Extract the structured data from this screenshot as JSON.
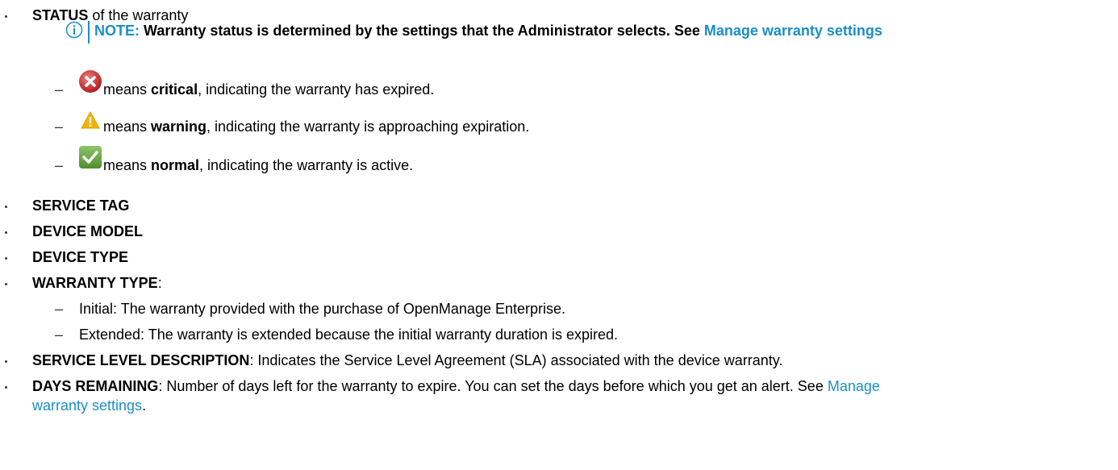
{
  "status_item": {
    "label": "STATUS",
    "rest": " of the warranty"
  },
  "note": {
    "label": "NOTE:",
    "text": " Warranty status is determined by the settings that the Administrator selects. See ",
    "link": "Manage warranty settings"
  },
  "status_critical": {
    "pre": " means ",
    "bold": "critical",
    "post": ", indicating the warranty has expired.",
    "icon": "critical-icon"
  },
  "status_warning": {
    "pre": " means ",
    "bold": "warning",
    "post": ", indicating the warranty is approaching expiration.",
    "icon": "warning-icon"
  },
  "status_normal": {
    "pre": " means ",
    "bold": "normal",
    "post": ", indicating the warranty is active.",
    "icon": "normal-check-icon"
  },
  "service_tag": "SERVICE TAG",
  "device_model": "DEVICE MODEL",
  "device_type": "DEVICE TYPE",
  "warranty_type": {
    "label": "WARRANTY TYPE",
    "colon": ":"
  },
  "warranty_initial": "Initial: The warranty provided with the purchase of OpenManage Enterprise.",
  "warranty_extended": "Extended: The warranty is extended because the initial warranty duration is expired.",
  "service_level": {
    "label": "SERVICE LEVEL DESCRIPTION",
    "text": ": Indicates the Service Level Agreement (SLA) associated with the device warranty."
  },
  "days_remaining": {
    "label": "DAYS REMAINING",
    "text": ": Number of days left for the warranty to expire. You can set the days before which you get an alert. See ",
    "link_part1": "Manage",
    "link_part2": "warranty settings",
    "end": "."
  },
  "colors": {
    "link": "#1a8fc9",
    "critical": "#c8282d",
    "warning": "#f2b400",
    "normal": "#6aa84f"
  }
}
